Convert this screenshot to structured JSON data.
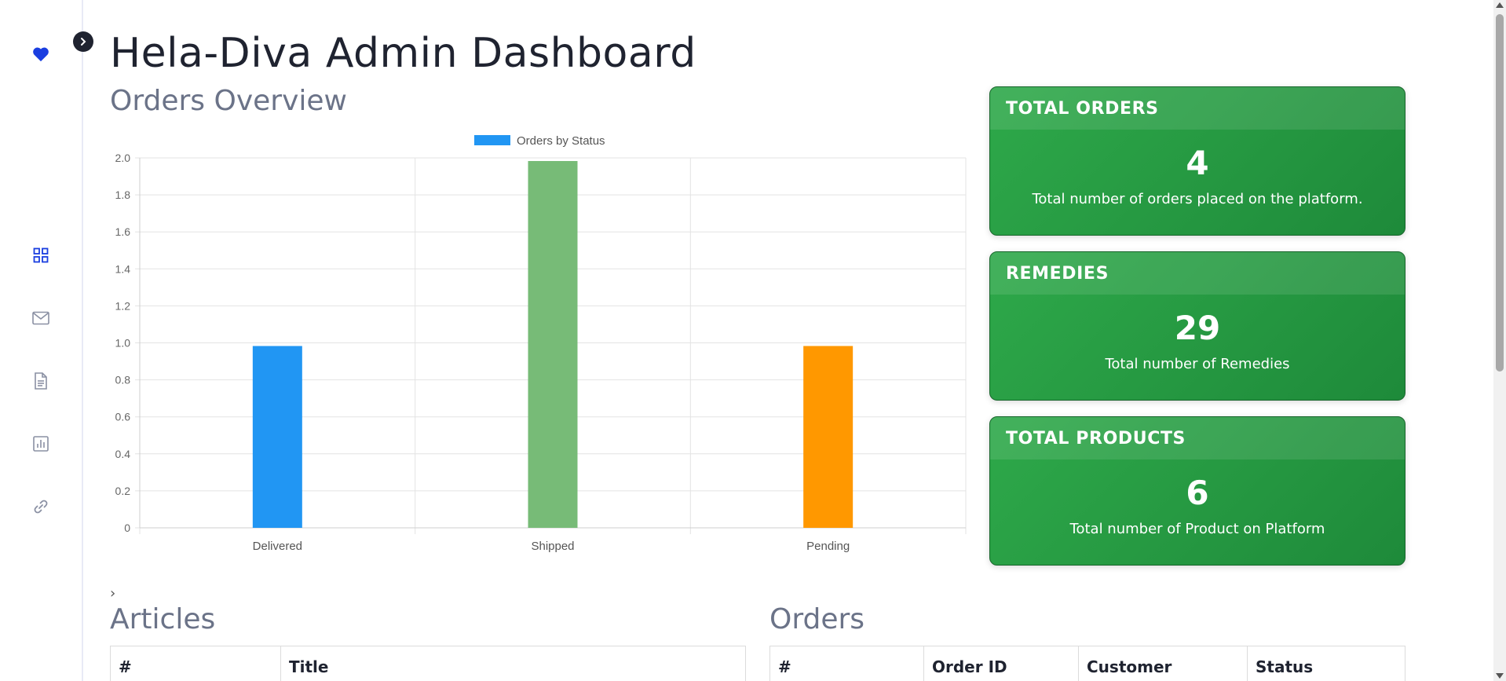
{
  "sidebar": {
    "items": [
      {
        "icon": "heart-icon"
      },
      {
        "icon": "dashboard-icon"
      },
      {
        "icon": "mail-icon"
      },
      {
        "icon": "document-icon"
      },
      {
        "icon": "bar-chart-icon"
      },
      {
        "icon": "link-icon"
      }
    ],
    "accent_color": "#1a3ee0",
    "icon_color": "#8a90a3"
  },
  "header": {
    "title": "Hela-Diva Admin Dashboard"
  },
  "orders_overview": {
    "title": "Orders Overview"
  },
  "chart_data": {
    "type": "bar",
    "categories": [
      "Delivered",
      "Shipped",
      "Pending"
    ],
    "series": [
      {
        "name": "Orders by Status",
        "values": [
          1,
          2,
          1
        ]
      }
    ],
    "bar_colors": [
      "#2196f3",
      "#77bb77",
      "#ff9800"
    ],
    "legend_color": "#2196f3",
    "y_ticks": [
      "0",
      "0.2",
      "0.4",
      "0.6",
      "0.8",
      "1.0",
      "1.2",
      "1.4",
      "1.6",
      "1.8",
      "2.0"
    ],
    "ylim": [
      0,
      2
    ],
    "grid": true,
    "legend_position": "top",
    "xlabel": "",
    "ylabel": ""
  },
  "cards": [
    {
      "title": "TOTAL ORDERS",
      "value": "4",
      "description": "Total number of orders placed on the platform."
    },
    {
      "title": "REMEDIES",
      "value": "29",
      "description": "Total number of Remedies"
    },
    {
      "title": "TOTAL PRODUCTS",
      "value": "6",
      "description": "Total number of Product on Platform"
    }
  ],
  "articles": {
    "title": "Articles",
    "columns": [
      "#",
      "Title"
    ]
  },
  "orders": {
    "title": "Orders",
    "columns": [
      "#",
      "Order ID",
      "Customer",
      "Status"
    ]
  },
  "collapse_glyph": "›"
}
